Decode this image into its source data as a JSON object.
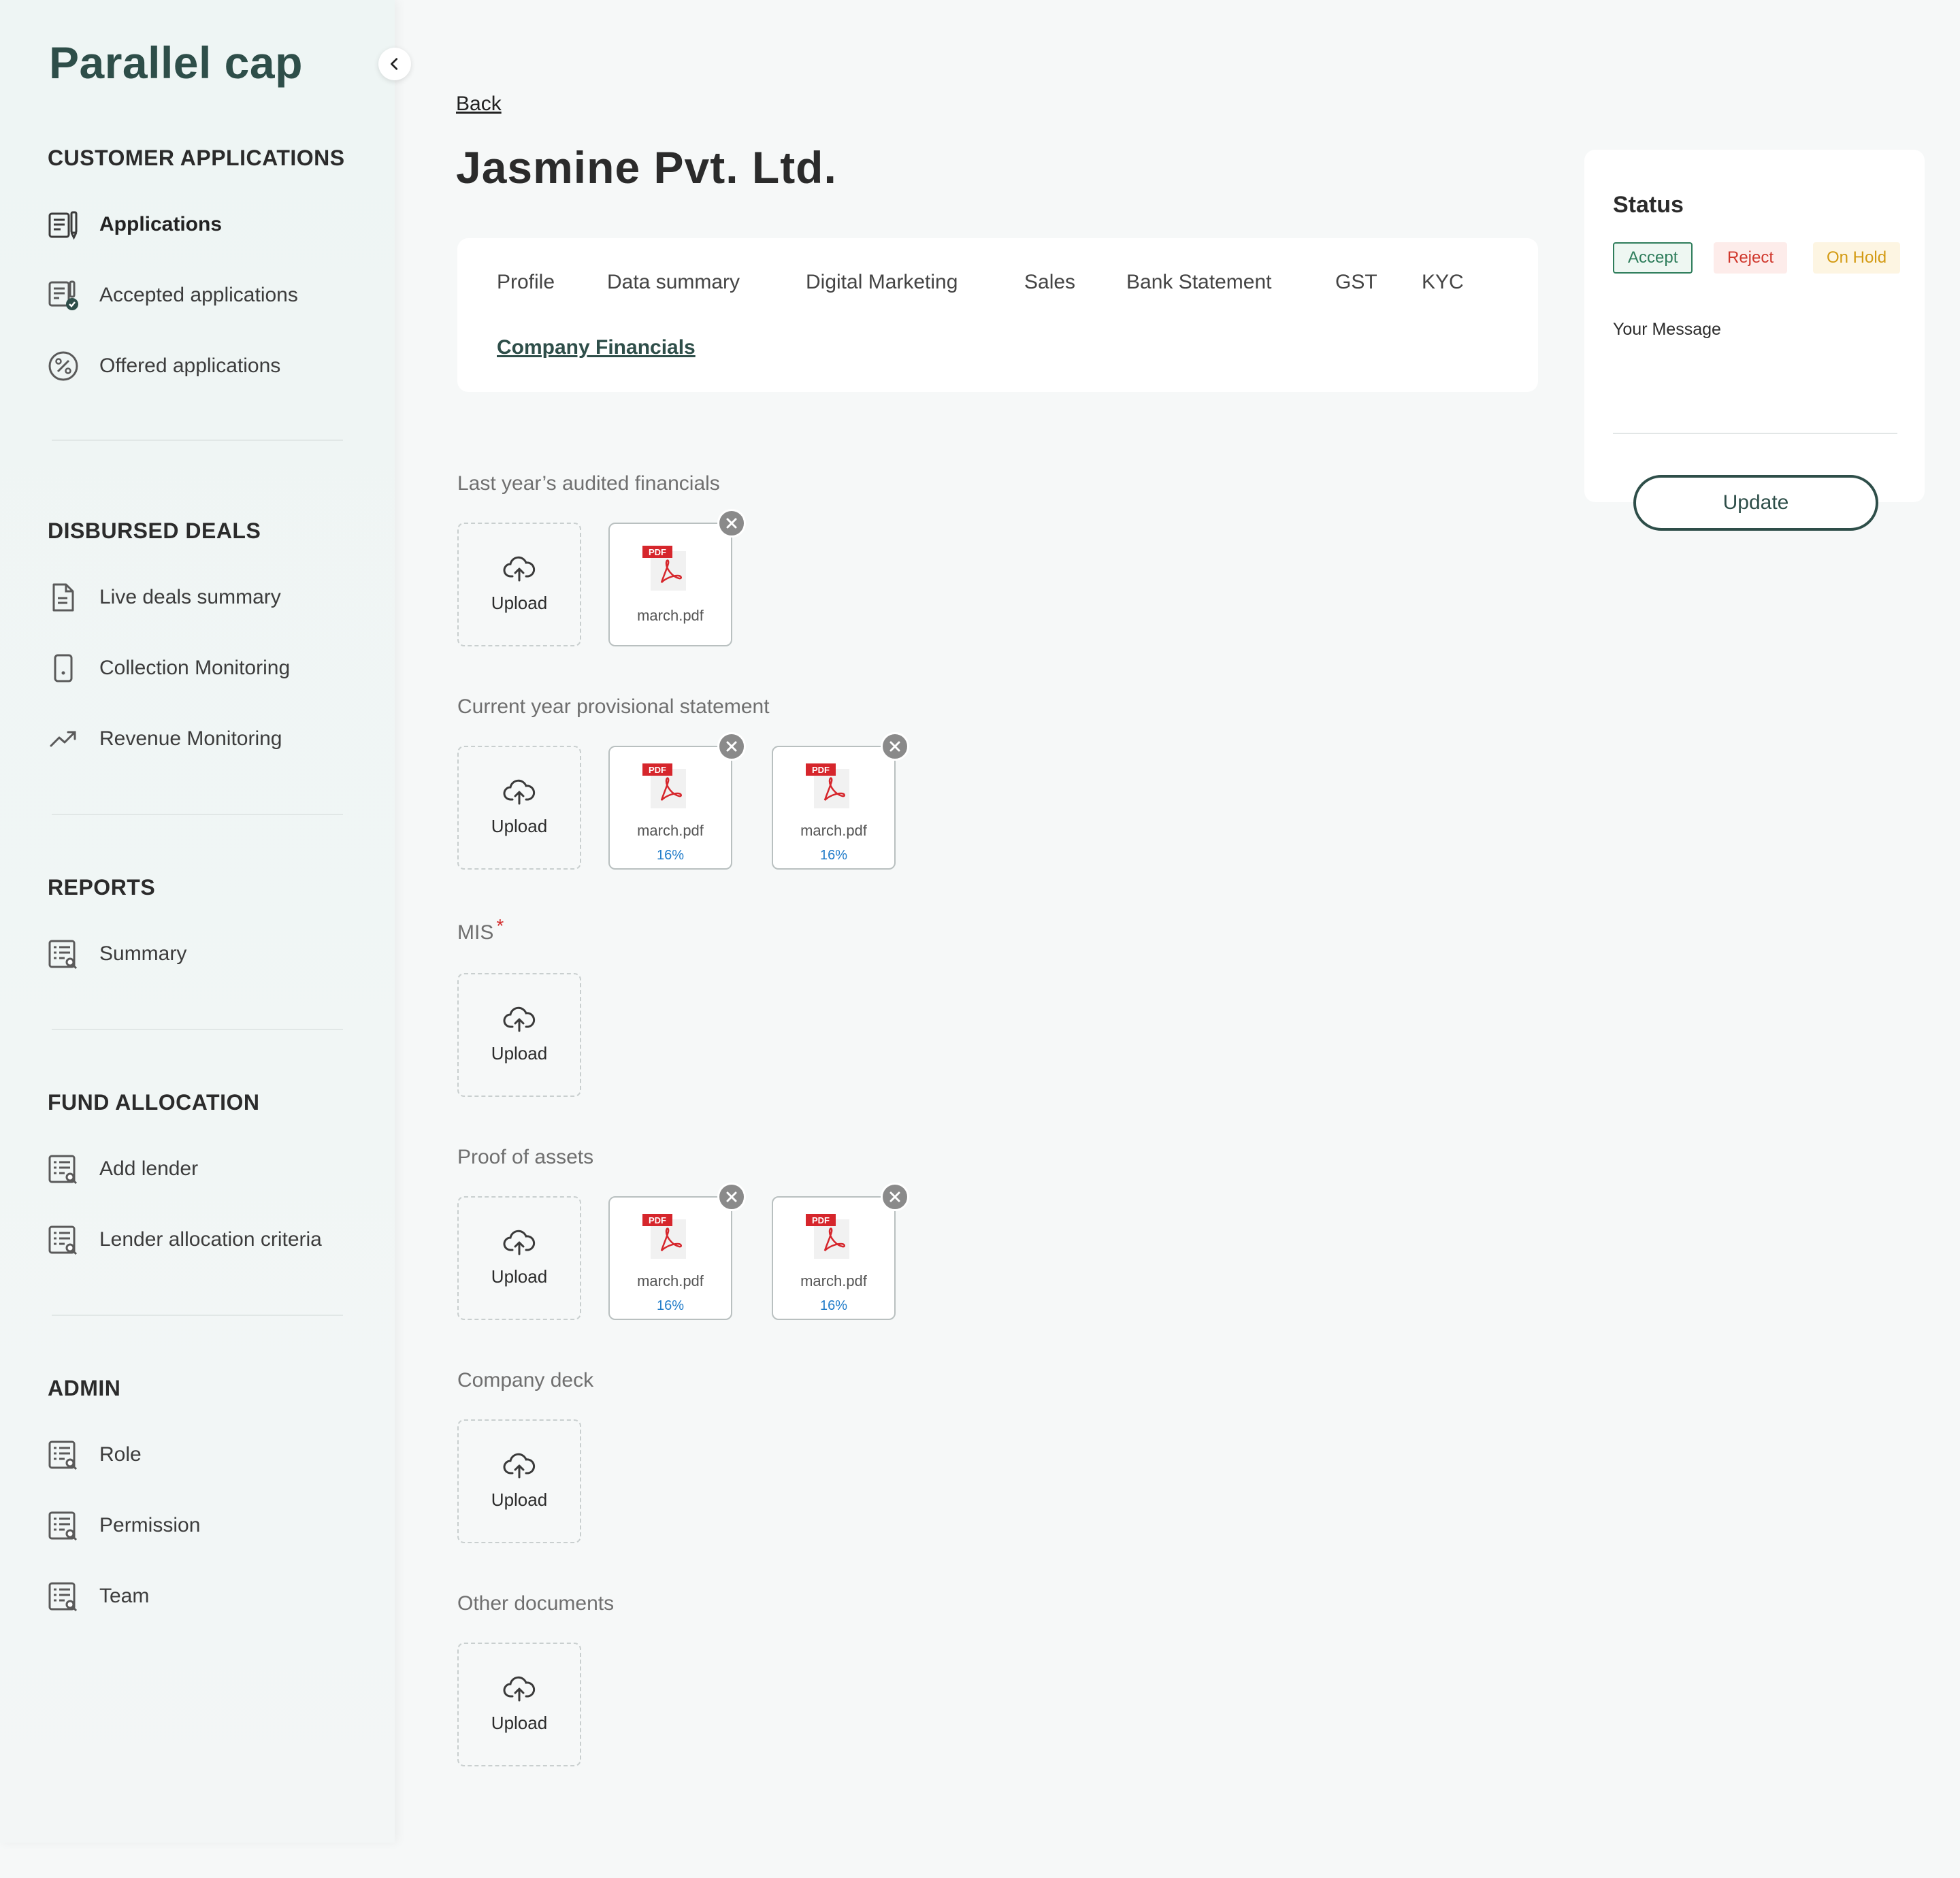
{
  "brand": "Parallel cap",
  "sidebar": {
    "sections": [
      {
        "title": "CUSTOMER APPLICATIONS",
        "items": [
          {
            "label": "Applications",
            "icon": "document-pen-icon",
            "active": true
          },
          {
            "label": "Accepted applications",
            "icon": "document-check-icon"
          },
          {
            "label": "Offered applications",
            "icon": "percent-circle-icon"
          }
        ]
      },
      {
        "title": "DISBURSED DEALS",
        "items": [
          {
            "label": "Live deals summary",
            "icon": "file-text-icon"
          },
          {
            "label": "Collection Monitoring",
            "icon": "mobile-icon"
          },
          {
            "label": "Revenue Monitoring",
            "icon": "trend-up-icon"
          }
        ]
      },
      {
        "title": "REPORTS",
        "items": [
          {
            "label": "Summary",
            "icon": "report-search-icon"
          }
        ]
      },
      {
        "title": "FUND ALLOCATION",
        "items": [
          {
            "label": "Add lender",
            "icon": "report-search-icon"
          },
          {
            "label": "Lender allocation criteria",
            "icon": "report-search-icon"
          }
        ]
      },
      {
        "title": "ADMIN",
        "items": [
          {
            "label": "Role",
            "icon": "report-search-icon"
          },
          {
            "label": "Permission",
            "icon": "report-search-icon"
          },
          {
            "label": "Team",
            "icon": "report-search-icon"
          }
        ]
      }
    ]
  },
  "main": {
    "back": "Back",
    "title": "Jasmine Pvt. Ltd.",
    "tabs": [
      "Profile",
      "Data summary",
      "Digital Marketing",
      "Sales",
      "Bank Statement",
      "GST",
      "KYC",
      "Company Financials"
    ],
    "active_tab": "Company Financials",
    "upload_label": "Upload",
    "groups": [
      {
        "label": "Last year’s audited financials",
        "files": [
          {
            "name": "march.pdf",
            "progress": ""
          }
        ]
      },
      {
        "label": "Current year provisional statement",
        "files": [
          {
            "name": "march.pdf",
            "progress": "16%"
          },
          {
            "name": "march.pdf",
            "progress": "16%"
          }
        ]
      },
      {
        "label": "MIS",
        "required": true,
        "files": []
      },
      {
        "label": "Proof of assets",
        "files": [
          {
            "name": "march.pdf",
            "progress": "16%"
          },
          {
            "name": "march.pdf",
            "progress": "16%"
          }
        ]
      },
      {
        "label": "Company deck",
        "files": []
      },
      {
        "label": "Other documents",
        "files": []
      }
    ]
  },
  "status": {
    "title": "Status",
    "options": [
      "Accept",
      "Reject",
      "On Hold"
    ],
    "message_label": "Your Message",
    "message_value": "",
    "update_button": "Update"
  },
  "colors": {
    "brand": "#2e4e49",
    "accept": "#2e7d5b",
    "reject": "#d0372c",
    "hold": "#d39a12",
    "progress": "#1f7bc9"
  }
}
